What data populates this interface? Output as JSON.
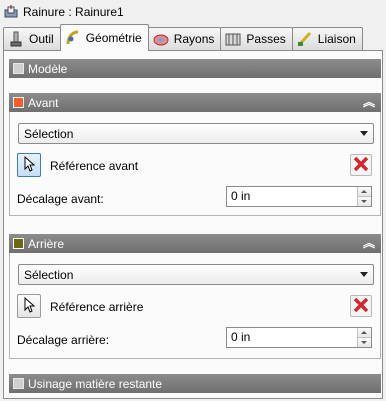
{
  "window": {
    "title": "Rainure : Rainure1",
    "icon": "groove-icon"
  },
  "tabs": [
    {
      "label": "Outil",
      "icon": "tool-icon",
      "active": false
    },
    {
      "label": "Géométrie",
      "icon": "geometry-icon",
      "active": true
    },
    {
      "label": "Rayons",
      "icon": "radii-icon",
      "active": false
    },
    {
      "label": "Passes",
      "icon": "passes-icon",
      "active": false
    },
    {
      "label": "Liaison",
      "icon": "linking-icon",
      "active": false
    }
  ],
  "modele": {
    "label": "Modèle",
    "checked": false
  },
  "avant": {
    "header": "Avant",
    "color": "#ff5a2a",
    "selection": "Sélection",
    "reference_label": "Référence avant",
    "offset_label": "Décalage avant:",
    "offset_value": "0 in"
  },
  "arriere": {
    "header": "Arrière",
    "color": "#6b6a0c",
    "selection": "Sélection",
    "reference_label": "Référence arrière",
    "offset_label": "Décalage arrière:",
    "offset_value": "0 in"
  },
  "rest_machining": {
    "label": "Usinage matière restante",
    "checked": false
  },
  "colors": {
    "header_bg": "#7d7d7d",
    "delete_red": "#d9262a",
    "cursor_blue": "#3b79c9"
  }
}
